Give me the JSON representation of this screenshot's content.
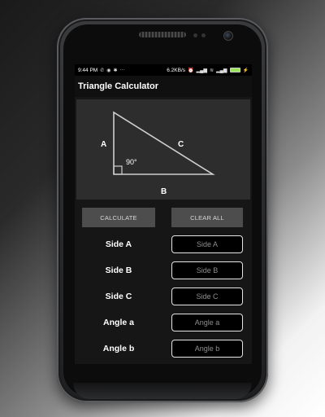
{
  "status_bar": {
    "time": "9:44 PM",
    "network_speed": "6.2KB/s",
    "battery_level": 1.0,
    "icons": [
      "settings-icon",
      "whatsapp-icon",
      "messenger-icon",
      "notification-icon",
      "more-dots-icon",
      "alarm-icon",
      "signal-icon",
      "wifi-icon",
      "signal-icon",
      "charging-icon"
    ]
  },
  "app": {
    "title": "Triangle Calculator"
  },
  "diagram": {
    "label_a": "A",
    "label_b": "B",
    "label_c": "C",
    "angle_label": "90°"
  },
  "buttons": {
    "calculate": "CALCULATE",
    "clear_all": "CLEAR ALL"
  },
  "fields": [
    {
      "label": "Side A",
      "placeholder": "Side A",
      "value": ""
    },
    {
      "label": "Side B",
      "placeholder": "Side B",
      "value": ""
    },
    {
      "label": "Side C",
      "placeholder": "Side C",
      "value": ""
    },
    {
      "label": "Angle a",
      "placeholder": "Angle a",
      "value": ""
    },
    {
      "label": "Angle b",
      "placeholder": "Angle b",
      "value": ""
    }
  ],
  "colors": {
    "screen_background": "#161616",
    "diagram_background": "#2d2d2d",
    "button_background": "#4d4d4d",
    "field_border": "#e5e5e5",
    "battery_fill": "#9be35b"
  }
}
